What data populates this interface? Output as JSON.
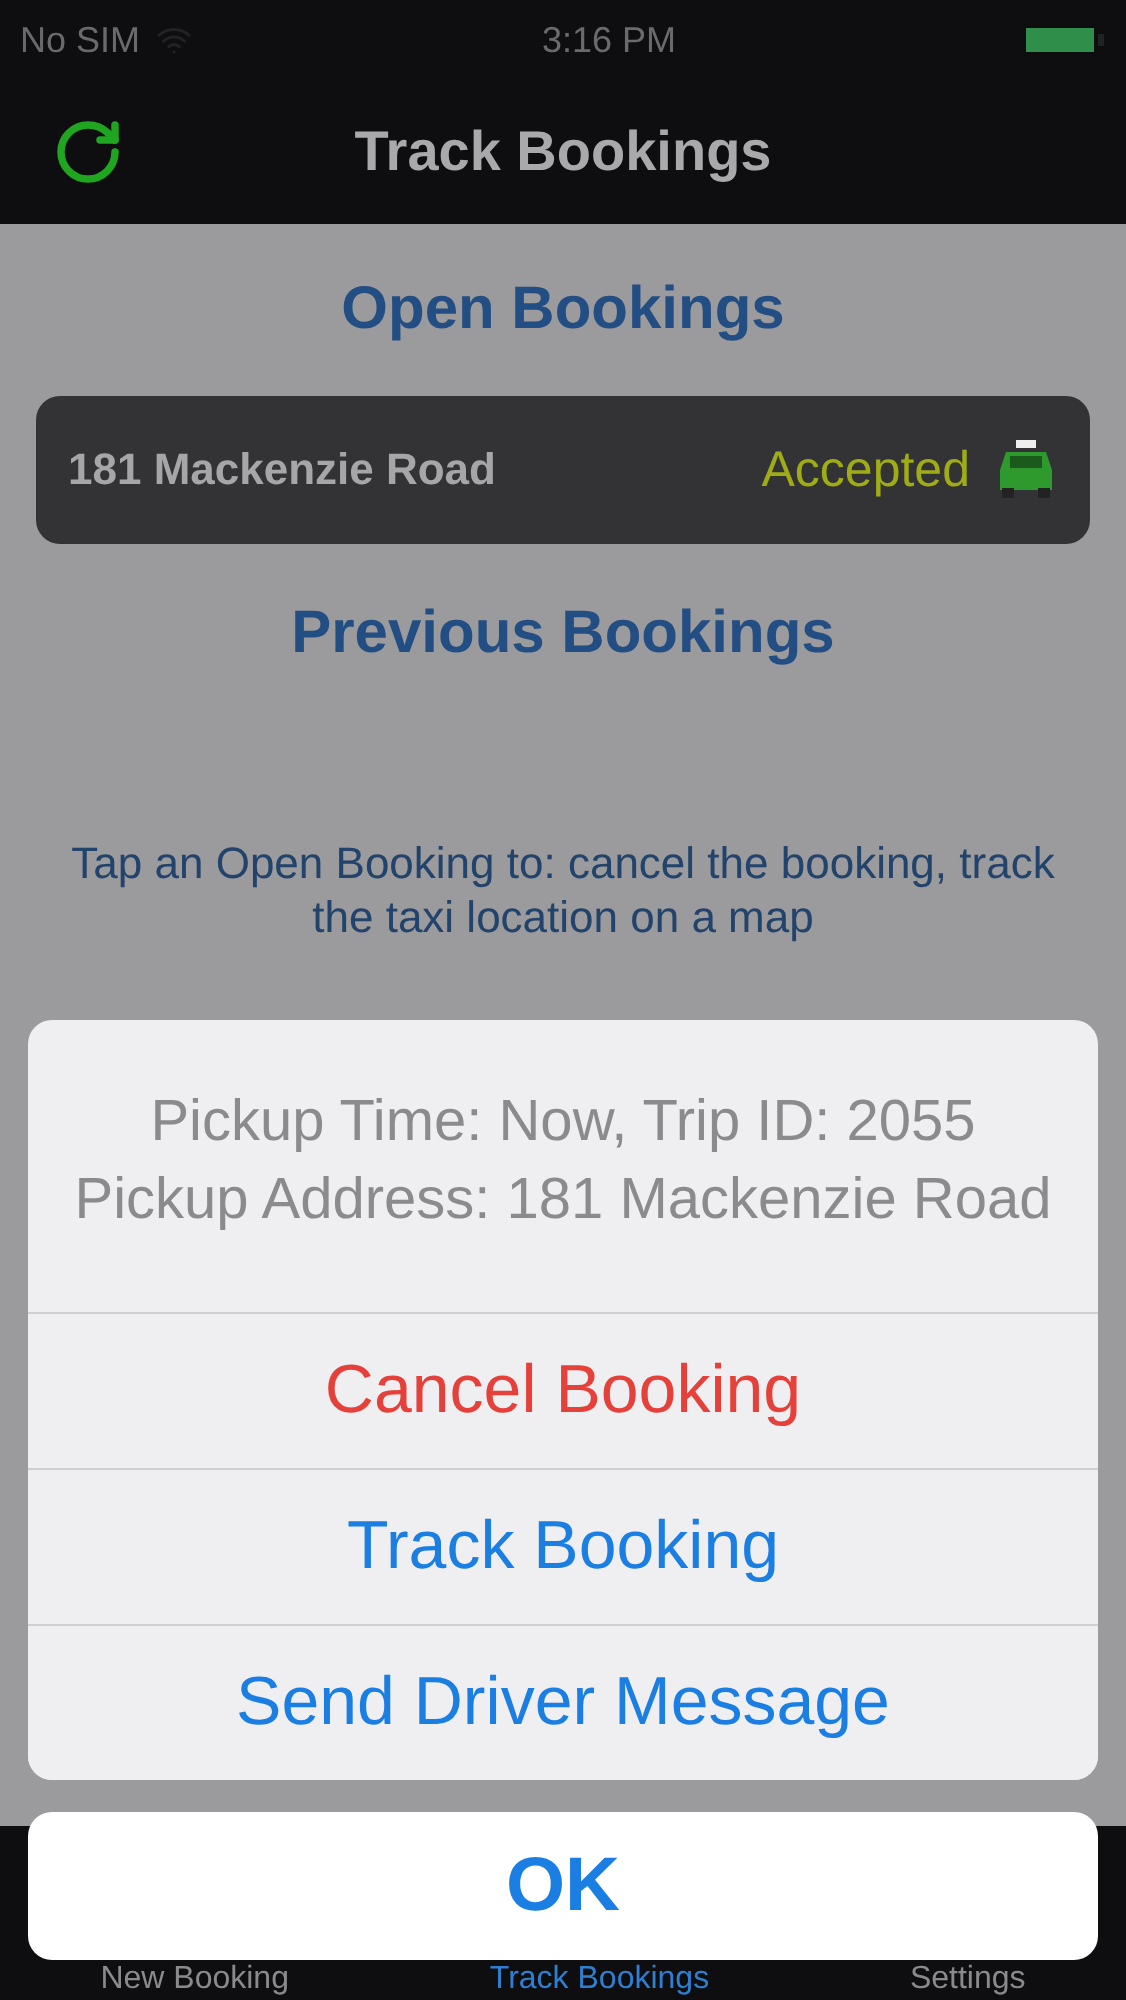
{
  "status_bar": {
    "carrier": "No SIM",
    "time": "3:16 PM"
  },
  "nav_bar": {
    "title": "Track Bookings"
  },
  "open_bookings": {
    "heading": "Open Bookings",
    "items": [
      {
        "address": "181 Mackenzie Road",
        "status": "Accepted"
      }
    ]
  },
  "previous_bookings": {
    "heading": "Previous Bookings"
  },
  "hint": "Tap an Open Booking to: cancel the booking, track the taxi location on a map",
  "action_sheet": {
    "message": [
      "Pickup Time: Now, Trip ID: 2055",
      "Pickup Address: 181 Mackenzie Road"
    ],
    "actions": [
      {
        "label": "Cancel Booking",
        "kind": "destructive"
      },
      {
        "label": "Track Booking",
        "kind": "default"
      },
      {
        "label": "Send Driver Message",
        "kind": "default"
      }
    ],
    "cancel": "OK"
  },
  "tab_bar": [
    {
      "label": "New Booking",
      "selected": false
    },
    {
      "label": "Track Bookings",
      "selected": true
    },
    {
      "label": "Settings",
      "selected": false
    }
  ]
}
